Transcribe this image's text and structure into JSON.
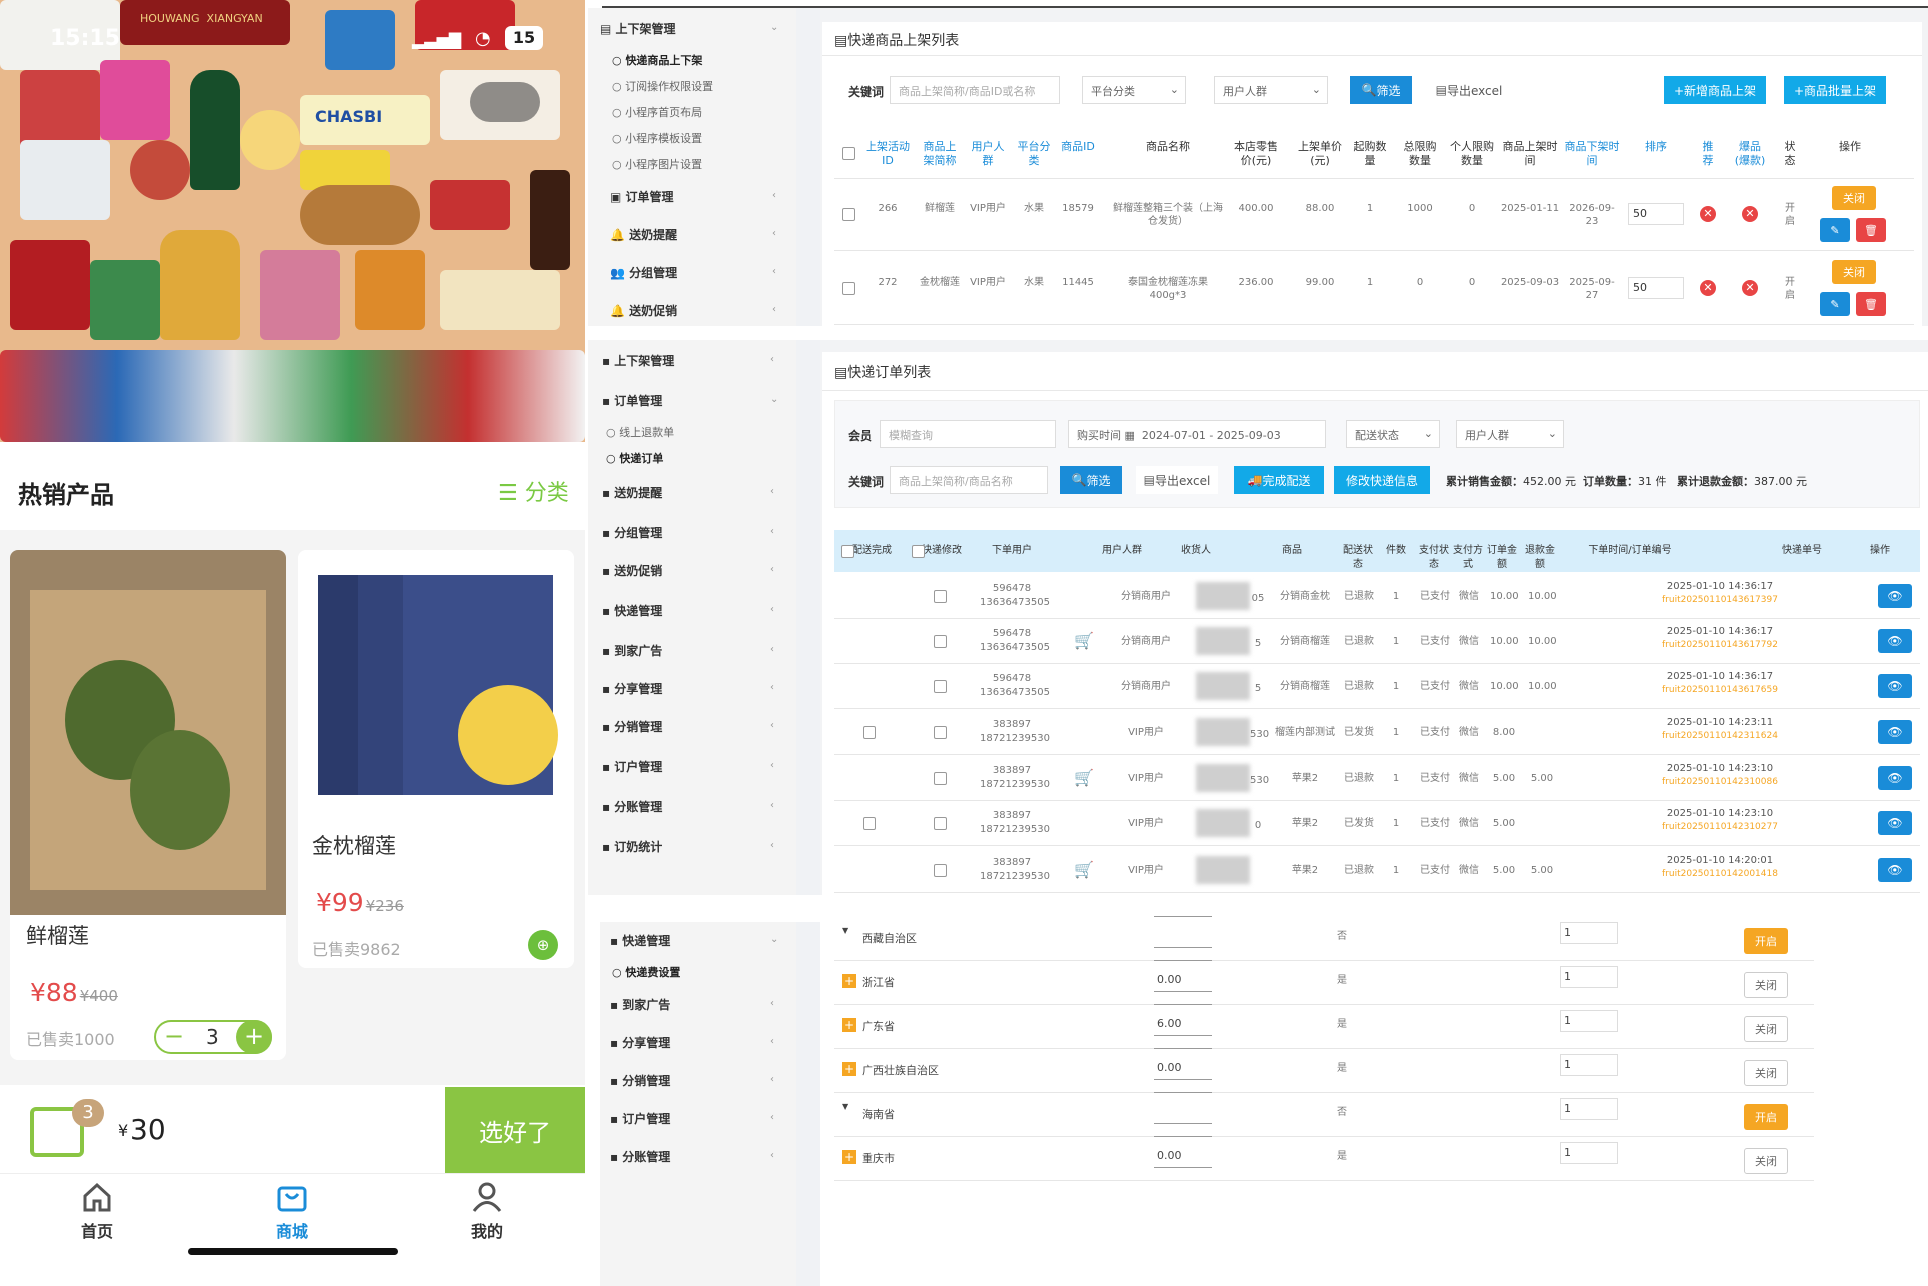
{
  "mobile": {
    "status": {
      "time": "15:15",
      "battery": "15"
    },
    "banner": {
      "brand_left": "HOUWANG",
      "brand_right": "XIANGYAN",
      "chasbi": "CHASBI"
    },
    "hot_title": "热销产品",
    "category_label": "分类",
    "products": [
      {
        "name": "鲜榴莲",
        "price": "¥88",
        "old_price": "¥400",
        "sold": "已售卖1000",
        "qty": "3"
      },
      {
        "name": "金枕榴莲",
        "price": "¥99",
        "old_price": "¥236",
        "sold": "已售卖9862"
      }
    ],
    "cart": {
      "badge": "3",
      "total": "30",
      "currency": "¥",
      "select_label": "选好了"
    },
    "tabs": [
      {
        "label": "首页"
      },
      {
        "label": "商城"
      },
      {
        "label": "我的"
      }
    ]
  },
  "panel1": {
    "sidebar": {
      "group": "上下架管理",
      "items": [
        "快递商品上下架",
        "订阅操作权限设置",
        "小程序首页布局",
        "小程序模板设置",
        "小程序图片设置"
      ],
      "menus": [
        "订单管理",
        "送奶提醒",
        "分组管理",
        "送奶促销"
      ]
    },
    "title": "快递商品上架列表",
    "filter": {
      "keyword_label": "关键词",
      "keyword_placeholder": "商品上架简称/商品ID或名称",
      "platform_select": "平台分类",
      "group_select": "用户人群",
      "filter_btn": "筛选",
      "export_btn": "导出excel",
      "add_btn": "+新增商品上架",
      "batch_btn": "+商品批量上架"
    },
    "headers": [
      "上架活动ID",
      "商品上架简称",
      "用户人群",
      "平台分类",
      "商品ID",
      "商品名称",
      "本店零售价(元)",
      "上架单价(元)",
      "起购数量",
      "总限购数量",
      "个人限购数量",
      "商品上架时间",
      "商品下架时间",
      "排序",
      "推荐",
      "爆品(爆款)",
      "状态",
      "操作"
    ],
    "rows": [
      {
        "id": "266",
        "short": "鲜榴莲",
        "group": "VIP用户",
        "cat": "水果",
        "pid": "18579",
        "name": "鲜榴莲整箱三个装（上海仓发货）",
        "retail": "400.00",
        "price": "88.00",
        "min": "1",
        "limit": "1000",
        "personal": "0",
        "up": "2025-01-11",
        "down": "2026-09-23",
        "sort": "50",
        "status": "开启",
        "off_btn": "关闭"
      },
      {
        "id": "272",
        "short": "金枕榴莲",
        "group": "VIP用户",
        "cat": "水果",
        "pid": "11445",
        "name": "泰国金枕榴莲冻果400g*3",
        "retail": "236.00",
        "price": "99.00",
        "min": "1",
        "limit": "0",
        "personal": "0",
        "up": "2025-09-03",
        "down": "2025-09-27",
        "sort": "50",
        "status": "开启",
        "off_btn": "关闭"
      }
    ]
  },
  "panel2": {
    "sidebar": {
      "items": [
        "上下架管理",
        "订单管理",
        "线上退款单",
        "快递订单",
        "送奶提醒",
        "分组管理",
        "送奶促销",
        "快递管理",
        "到家广告",
        "分享管理",
        "分销管理",
        "订户管理",
        "分账管理",
        "订奶统计"
      ]
    },
    "title": "快递订单列表",
    "filter": {
      "member_label": "会员",
      "member_placeholder": "模糊查询",
      "time_label": "购买时间",
      "date_range": "2024-07-01 - 2025-09-03",
      "delivery_select": "配送状态",
      "group_select": "用户人群",
      "keyword_label": "关键词",
      "keyword_placeholder": "商品上架简称/商品名称",
      "filter_btn": "筛选",
      "export_btn": "导出excel",
      "finish_btn": "完成配送",
      "modify_btn": "修改快递信息",
      "sales_label": "累计销售金额：",
      "sales_value": "452.00 元",
      "count_label": "订单数量：",
      "count_value": "31 件",
      "refund_label": "累计退款金额：",
      "refund_value": "387.00 元"
    },
    "headers": [
      "配送完成",
      "快递修改",
      "下单用户",
      "用户人群",
      "收货人",
      "商品",
      "配送状态",
      "件数",
      "支付状态",
      "支付方式",
      "订单金额",
      "退款金额",
      "下单时间/订单编号",
      "快递单号",
      "操作"
    ],
    "rows": [
      {
        "user": "596478",
        "phone": "13636473505",
        "group": "分销商用户",
        "recv_tail": "05",
        "item": "分销商金枕",
        "dstatus": "已退款",
        "qty": "1",
        "pay": "已支付",
        "way": "微信",
        "amount": "10.00",
        "refund": "10.00",
        "time": "2025-01-10 14:36:17",
        "no": "fruit20250110143617397"
      },
      {
        "user": "596478",
        "phone": "13636473505",
        "group": "分销商用户",
        "recv_tail": "5",
        "item": "分销商榴莲",
        "dstatus": "已退款",
        "qty": "1",
        "pay": "已支付",
        "way": "微信",
        "amount": "10.00",
        "refund": "10.00",
        "time": "2025-01-10 14:36:17",
        "no": "fruit20250110143617792"
      },
      {
        "user": "596478",
        "phone": "13636473505",
        "group": "分销商用户",
        "recv_tail": "5",
        "item": "分销商榴莲",
        "dstatus": "已退款",
        "qty": "1",
        "pay": "已支付",
        "way": "微信",
        "amount": "10.00",
        "refund": "10.00",
        "time": "2025-01-10 14:36:17",
        "no": "fruit20250110143617659"
      },
      {
        "user": "383897",
        "phone": "18721239530",
        "group": "VIP用户",
        "recv_tail": "530",
        "item": "榴莲内部测试",
        "dstatus": "已发货",
        "qty": "1",
        "pay": "已支付",
        "way": "微信",
        "amount": "8.00",
        "refund": "",
        "time": "2025-01-10 14:23:11",
        "no": "fruit20250110142311624"
      },
      {
        "user": "383897",
        "phone": "18721239530",
        "group": "VIP用户",
        "recv_tail": "530",
        "item": "苹果2",
        "dstatus": "已退款",
        "qty": "1",
        "pay": "已支付",
        "way": "微信",
        "amount": "5.00",
        "refund": "5.00",
        "time": "2025-01-10 14:23:10",
        "no": "fruit20250110142310086"
      },
      {
        "user": "383897",
        "phone": "18721239530",
        "group": "VIP用户",
        "recv_tail": "0",
        "item": "苹果2",
        "dstatus": "已发货",
        "qty": "1",
        "pay": "已支付",
        "way": "微信",
        "amount": "5.00",
        "refund": "",
        "time": "2025-01-10 14:23:10",
        "no": "fruit20250110142310277"
      },
      {
        "user": "383897",
        "phone": "18721239530",
        "group": "VIP用户",
        "recv_tail": "",
        "item": "苹果2",
        "dstatus": "已退款",
        "qty": "1",
        "pay": "已支付",
        "way": "微信",
        "amount": "5.00",
        "refund": "5.00",
        "time": "2025-01-10 14:20:01",
        "no": "fruit20250110142001418"
      }
    ]
  },
  "panel3": {
    "sidebar": {
      "group": "快递管理",
      "items": [
        "快递费设置"
      ],
      "menus": [
        "到家广告",
        "分享管理",
        "分销管理",
        "订户管理",
        "分账管理"
      ]
    },
    "rows": [
      {
        "region": "西藏自治区",
        "fee": "",
        "flag": "否",
        "sort": "1",
        "btn": "开启"
      },
      {
        "region": "浙江省",
        "fee": "0.00",
        "flag": "是",
        "sort": "1",
        "btn": "关闭"
      },
      {
        "region": "广东省",
        "fee": "6.00",
        "flag": "是",
        "sort": "1",
        "btn": "关闭"
      },
      {
        "region": "广西壮族自治区",
        "fee": "0.00",
        "flag": "是",
        "sort": "1",
        "btn": "关闭"
      },
      {
        "region": "海南省",
        "fee": "",
        "flag": "否",
        "sort": "1",
        "btn": "开启"
      },
      {
        "region": "重庆市",
        "fee": "0.00",
        "flag": "是",
        "sort": "1",
        "btn": "关闭"
      }
    ]
  },
  "colors": {
    "green": "#8ac543",
    "blue": "#1a8cd8",
    "orange": "#f5a623",
    "red": "#e84545"
  }
}
